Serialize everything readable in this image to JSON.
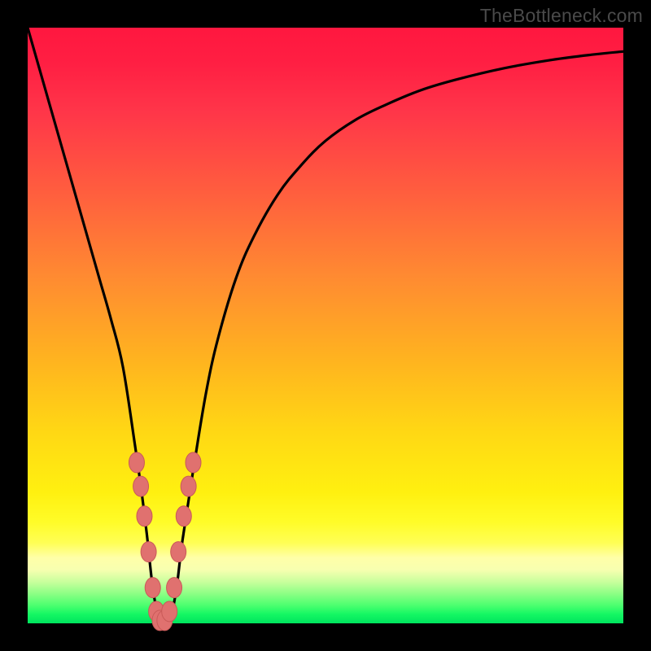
{
  "watermark": "TheBottleneck.com",
  "colors": {
    "curve": "#000000",
    "marker_fill": "#e0716f",
    "marker_stroke": "#c95a58",
    "bg_black": "#000000"
  },
  "chart_data": {
    "type": "line",
    "title": "",
    "xlabel": "",
    "ylabel": "",
    "xlim": [
      0,
      100
    ],
    "ylim": [
      0,
      100
    ],
    "x": [
      0,
      2,
      4,
      6,
      8,
      10,
      12,
      14,
      16,
      18,
      19,
      20,
      21,
      22,
      23,
      24,
      25,
      26,
      28,
      30,
      32,
      35,
      38,
      42,
      46,
      50,
      55,
      60,
      66,
      72,
      80,
      88,
      95,
      100
    ],
    "values": [
      100,
      93,
      86,
      79,
      72,
      65,
      58,
      51,
      43,
      30,
      23,
      15,
      6,
      1,
      0.5,
      1,
      6,
      14,
      27,
      39,
      48,
      58,
      65,
      72,
      77,
      81,
      84.5,
      87,
      89.5,
      91.3,
      93.2,
      94.6,
      95.5,
      96
    ],
    "markers": {
      "x": [
        18.3,
        19.0,
        19.6,
        20.3,
        21.0,
        21.6,
        22.2,
        23.0,
        23.8,
        24.6,
        25.3,
        26.2,
        27.0,
        27.8
      ],
      "y": [
        27,
        23,
        18,
        12,
        6,
        2,
        0.5,
        0.5,
        2,
        6,
        12,
        18,
        23,
        27
      ]
    },
    "grid": false,
    "legend": false
  }
}
